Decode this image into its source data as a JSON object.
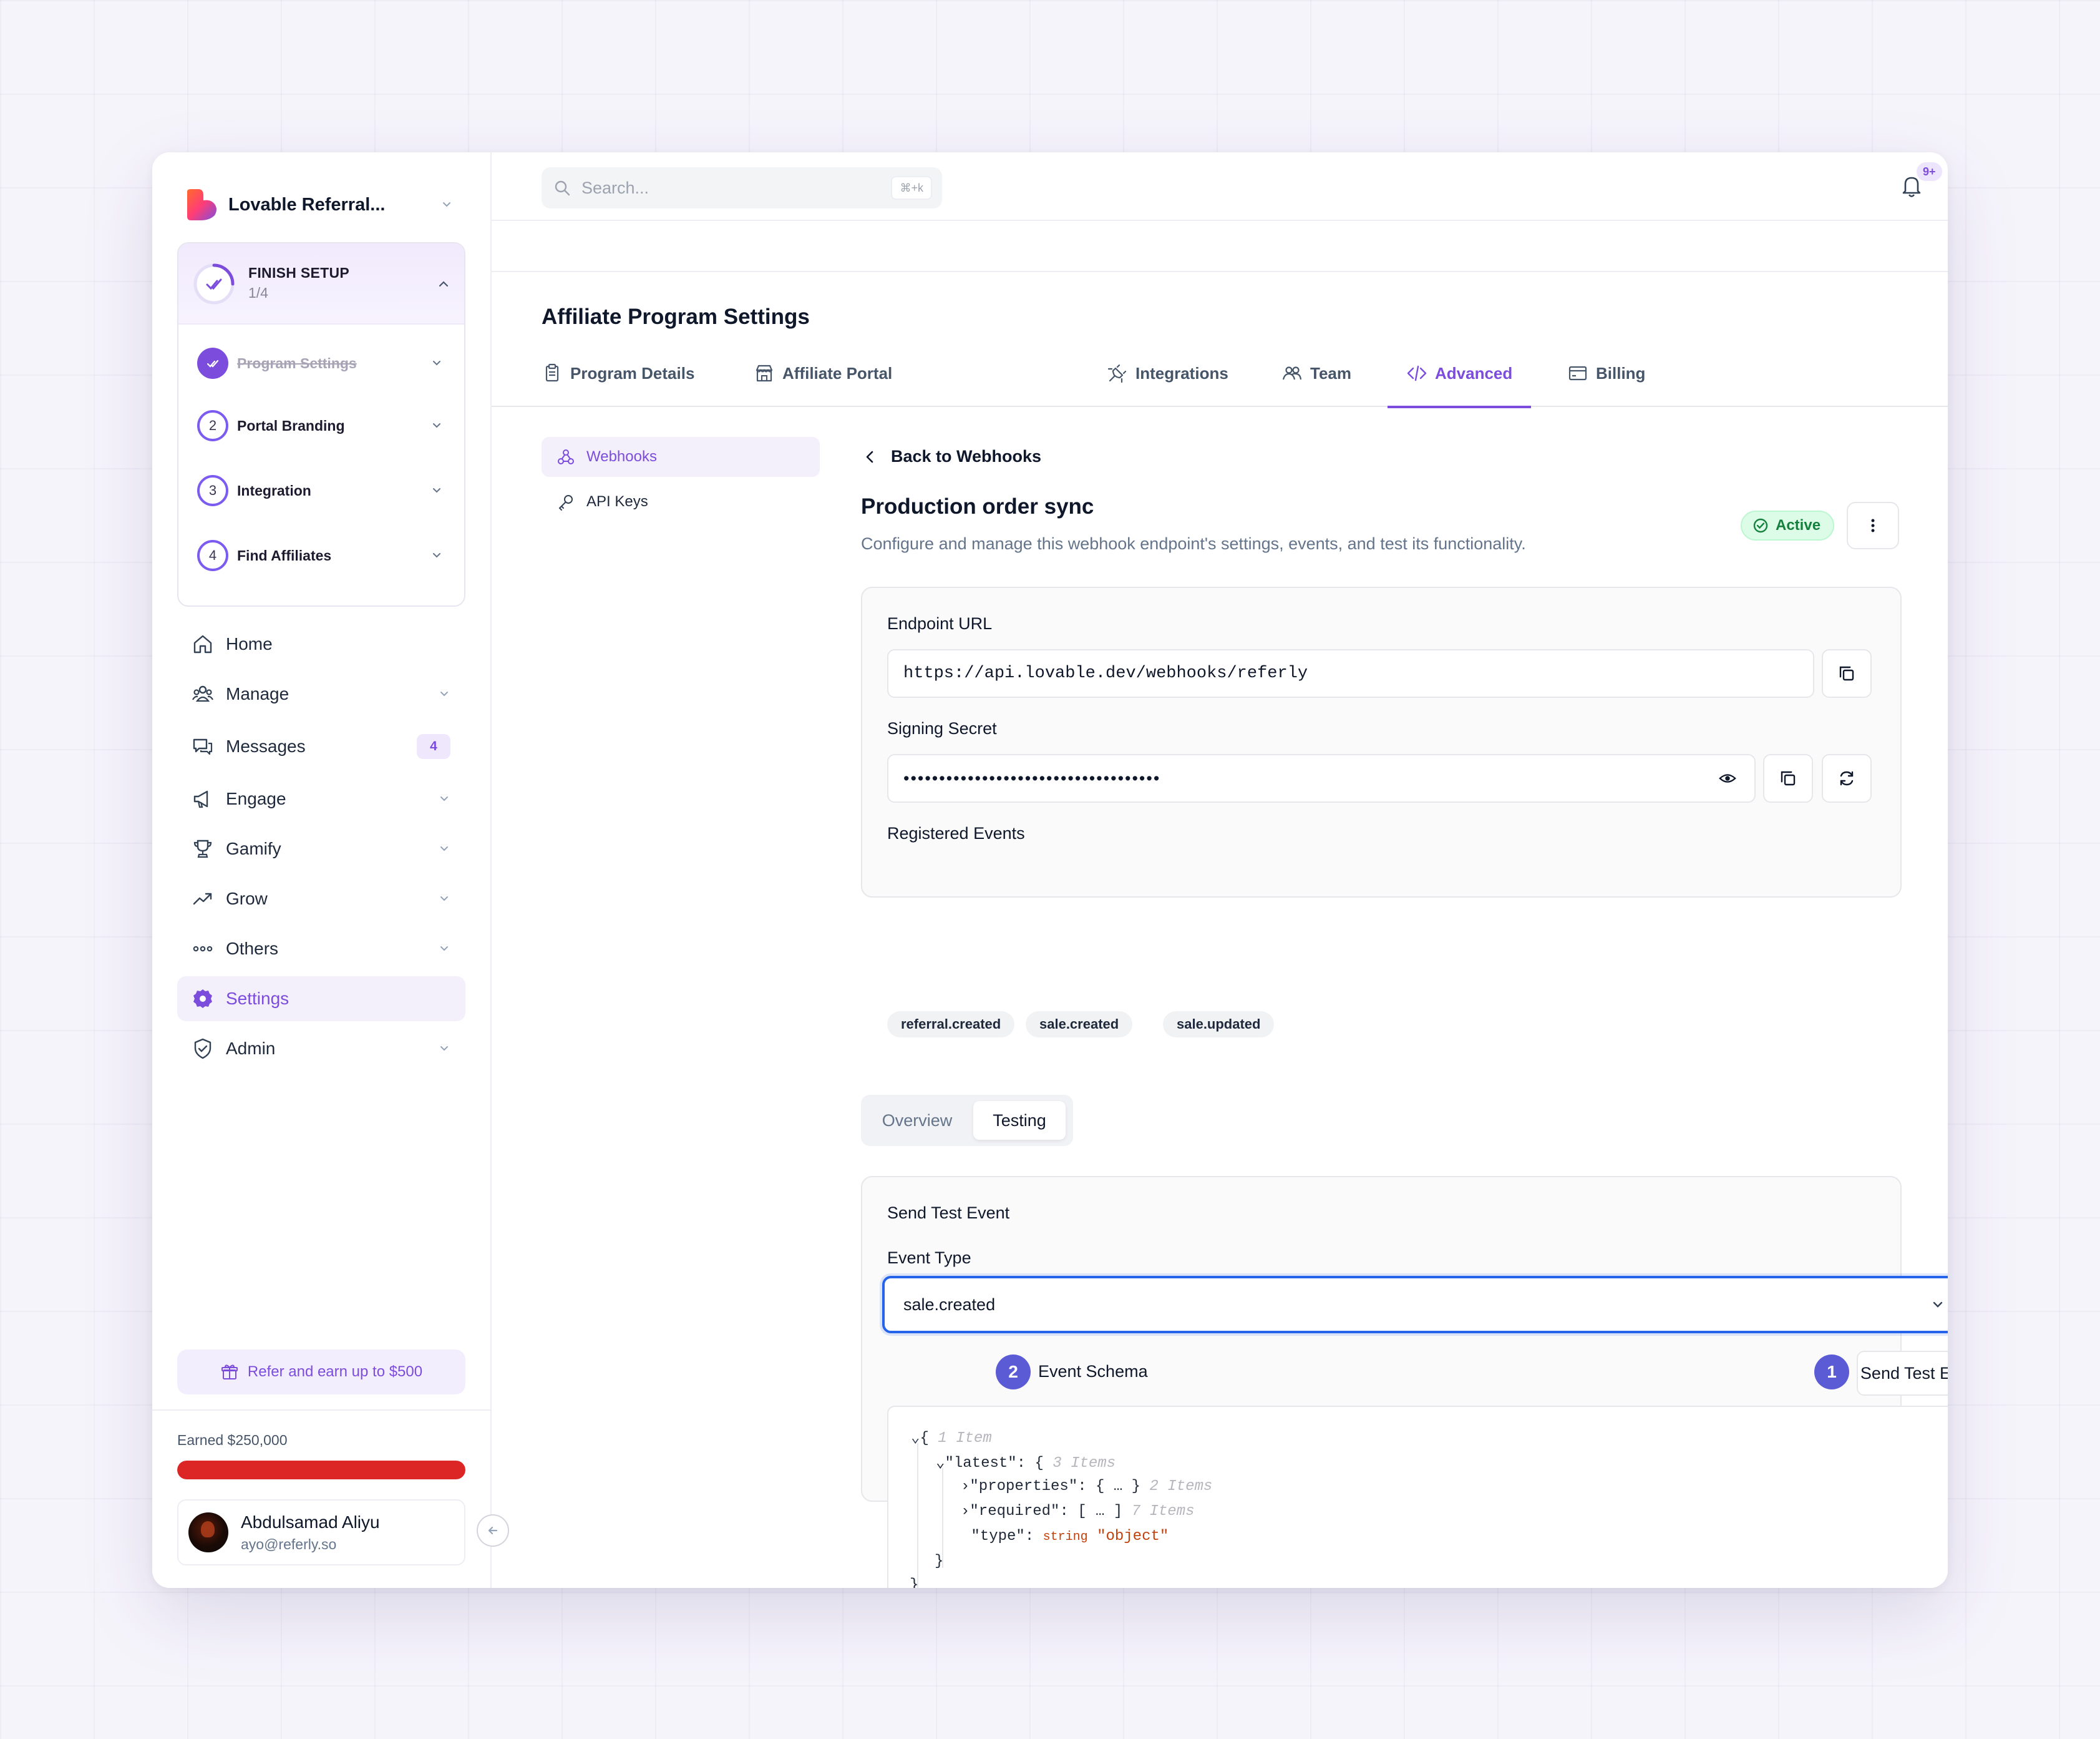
{
  "sidebar": {
    "brand": "Lovable Referral...",
    "setup": {
      "title": "FINISH SETUP",
      "count": "1/4",
      "steps": [
        {
          "num": "",
          "label": "Program Settings",
          "done": true
        },
        {
          "num": "2",
          "label": "Portal Branding",
          "done": false
        },
        {
          "num": "3",
          "label": "Integration",
          "done": false
        },
        {
          "num": "4",
          "label": "Find Affiliates",
          "done": false
        }
      ]
    },
    "nav": [
      {
        "label": "Home",
        "icon": "home-icon"
      },
      {
        "label": "Manage",
        "icon": "users-icon"
      },
      {
        "label": "Messages",
        "icon": "messages-icon",
        "badge": "4"
      },
      {
        "label": "Engage",
        "icon": "megaphone-icon"
      },
      {
        "label": "Gamify",
        "icon": "trophy-icon"
      },
      {
        "label": "Grow",
        "icon": "trending-up-icon"
      },
      {
        "label": "Others",
        "icon": "more-horizontal-icon"
      },
      {
        "label": "Settings",
        "icon": "gear-icon",
        "active": true
      },
      {
        "label": "Admin",
        "icon": "shield-check-icon"
      }
    ],
    "refer": "Refer and earn up to $500",
    "earned": "Earned $250,000",
    "earned_progress": 1.0,
    "user": {
      "name": "Abdulsamad Aliyu",
      "email": "ayo@referly.so"
    }
  },
  "topbar": {
    "search_placeholder": "Search...",
    "shortcut": "⌘+k",
    "notification_count": "9+"
  },
  "page": {
    "title": "Affiliate Program Settings",
    "tabs": [
      {
        "label": "Program Details",
        "icon": "clipboard-icon"
      },
      {
        "label": "Affiliate Portal",
        "icon": "store-icon"
      },
      {
        "label": "Integrations",
        "icon": "plug-icon"
      },
      {
        "label": "Team",
        "icon": "team-icon"
      },
      {
        "label": "Advanced",
        "icon": "code-icon",
        "active": true
      },
      {
        "label": "Billing",
        "icon": "credit-card-icon"
      }
    ],
    "subnav": [
      {
        "label": "Webhooks",
        "icon": "webhook-icon",
        "active": true
      },
      {
        "label": "API Keys",
        "icon": "key-icon"
      }
    ]
  },
  "webhook": {
    "back_label": "Back to Webhooks",
    "title": "Production order sync",
    "description": "Configure and manage this webhook endpoint's settings, events, and test its functionality.",
    "status": "Active",
    "endpoint_label": "Endpoint URL",
    "endpoint_url": "https://api.lovable.dev/webhooks/referly",
    "secret_label": "Signing Secret",
    "secret_masked": "••••••••••••••••••••••••••••••••••••",
    "events_label": "Registered Events",
    "events": [
      "referral.created",
      "sale.created",
      "sale.updated"
    ]
  },
  "view_tabs": {
    "overview": "Overview",
    "testing": "Testing"
  },
  "testing": {
    "section_title": "Send Test Event",
    "event_type_label": "Event Type",
    "event_type_value": "sale.created",
    "schema_label": "Event Schema",
    "send_button": "Send Test Event",
    "badge_schema": "2",
    "badge_send": "1"
  },
  "schema": {
    "l1_brace": "{",
    "l1_meta": "1 Item",
    "l2_key": "\"latest\"",
    "l2_colon": ":",
    "l2_brace": "{",
    "l2_meta": "3 Items",
    "l3_key": "\"properties\"",
    "l3_colon": ":",
    "l3_value": "{ … }",
    "l3_meta": "2 Items",
    "l4_key": "\"required\"",
    "l4_colon": ":",
    "l4_value": "[ … ]",
    "l4_meta": "7 Items",
    "l5_key": "\"type\"",
    "l5_colon": ":",
    "l5_type": "string",
    "l5_value": "\"object\"",
    "l6_close": "}",
    "l7_close": "}"
  }
}
